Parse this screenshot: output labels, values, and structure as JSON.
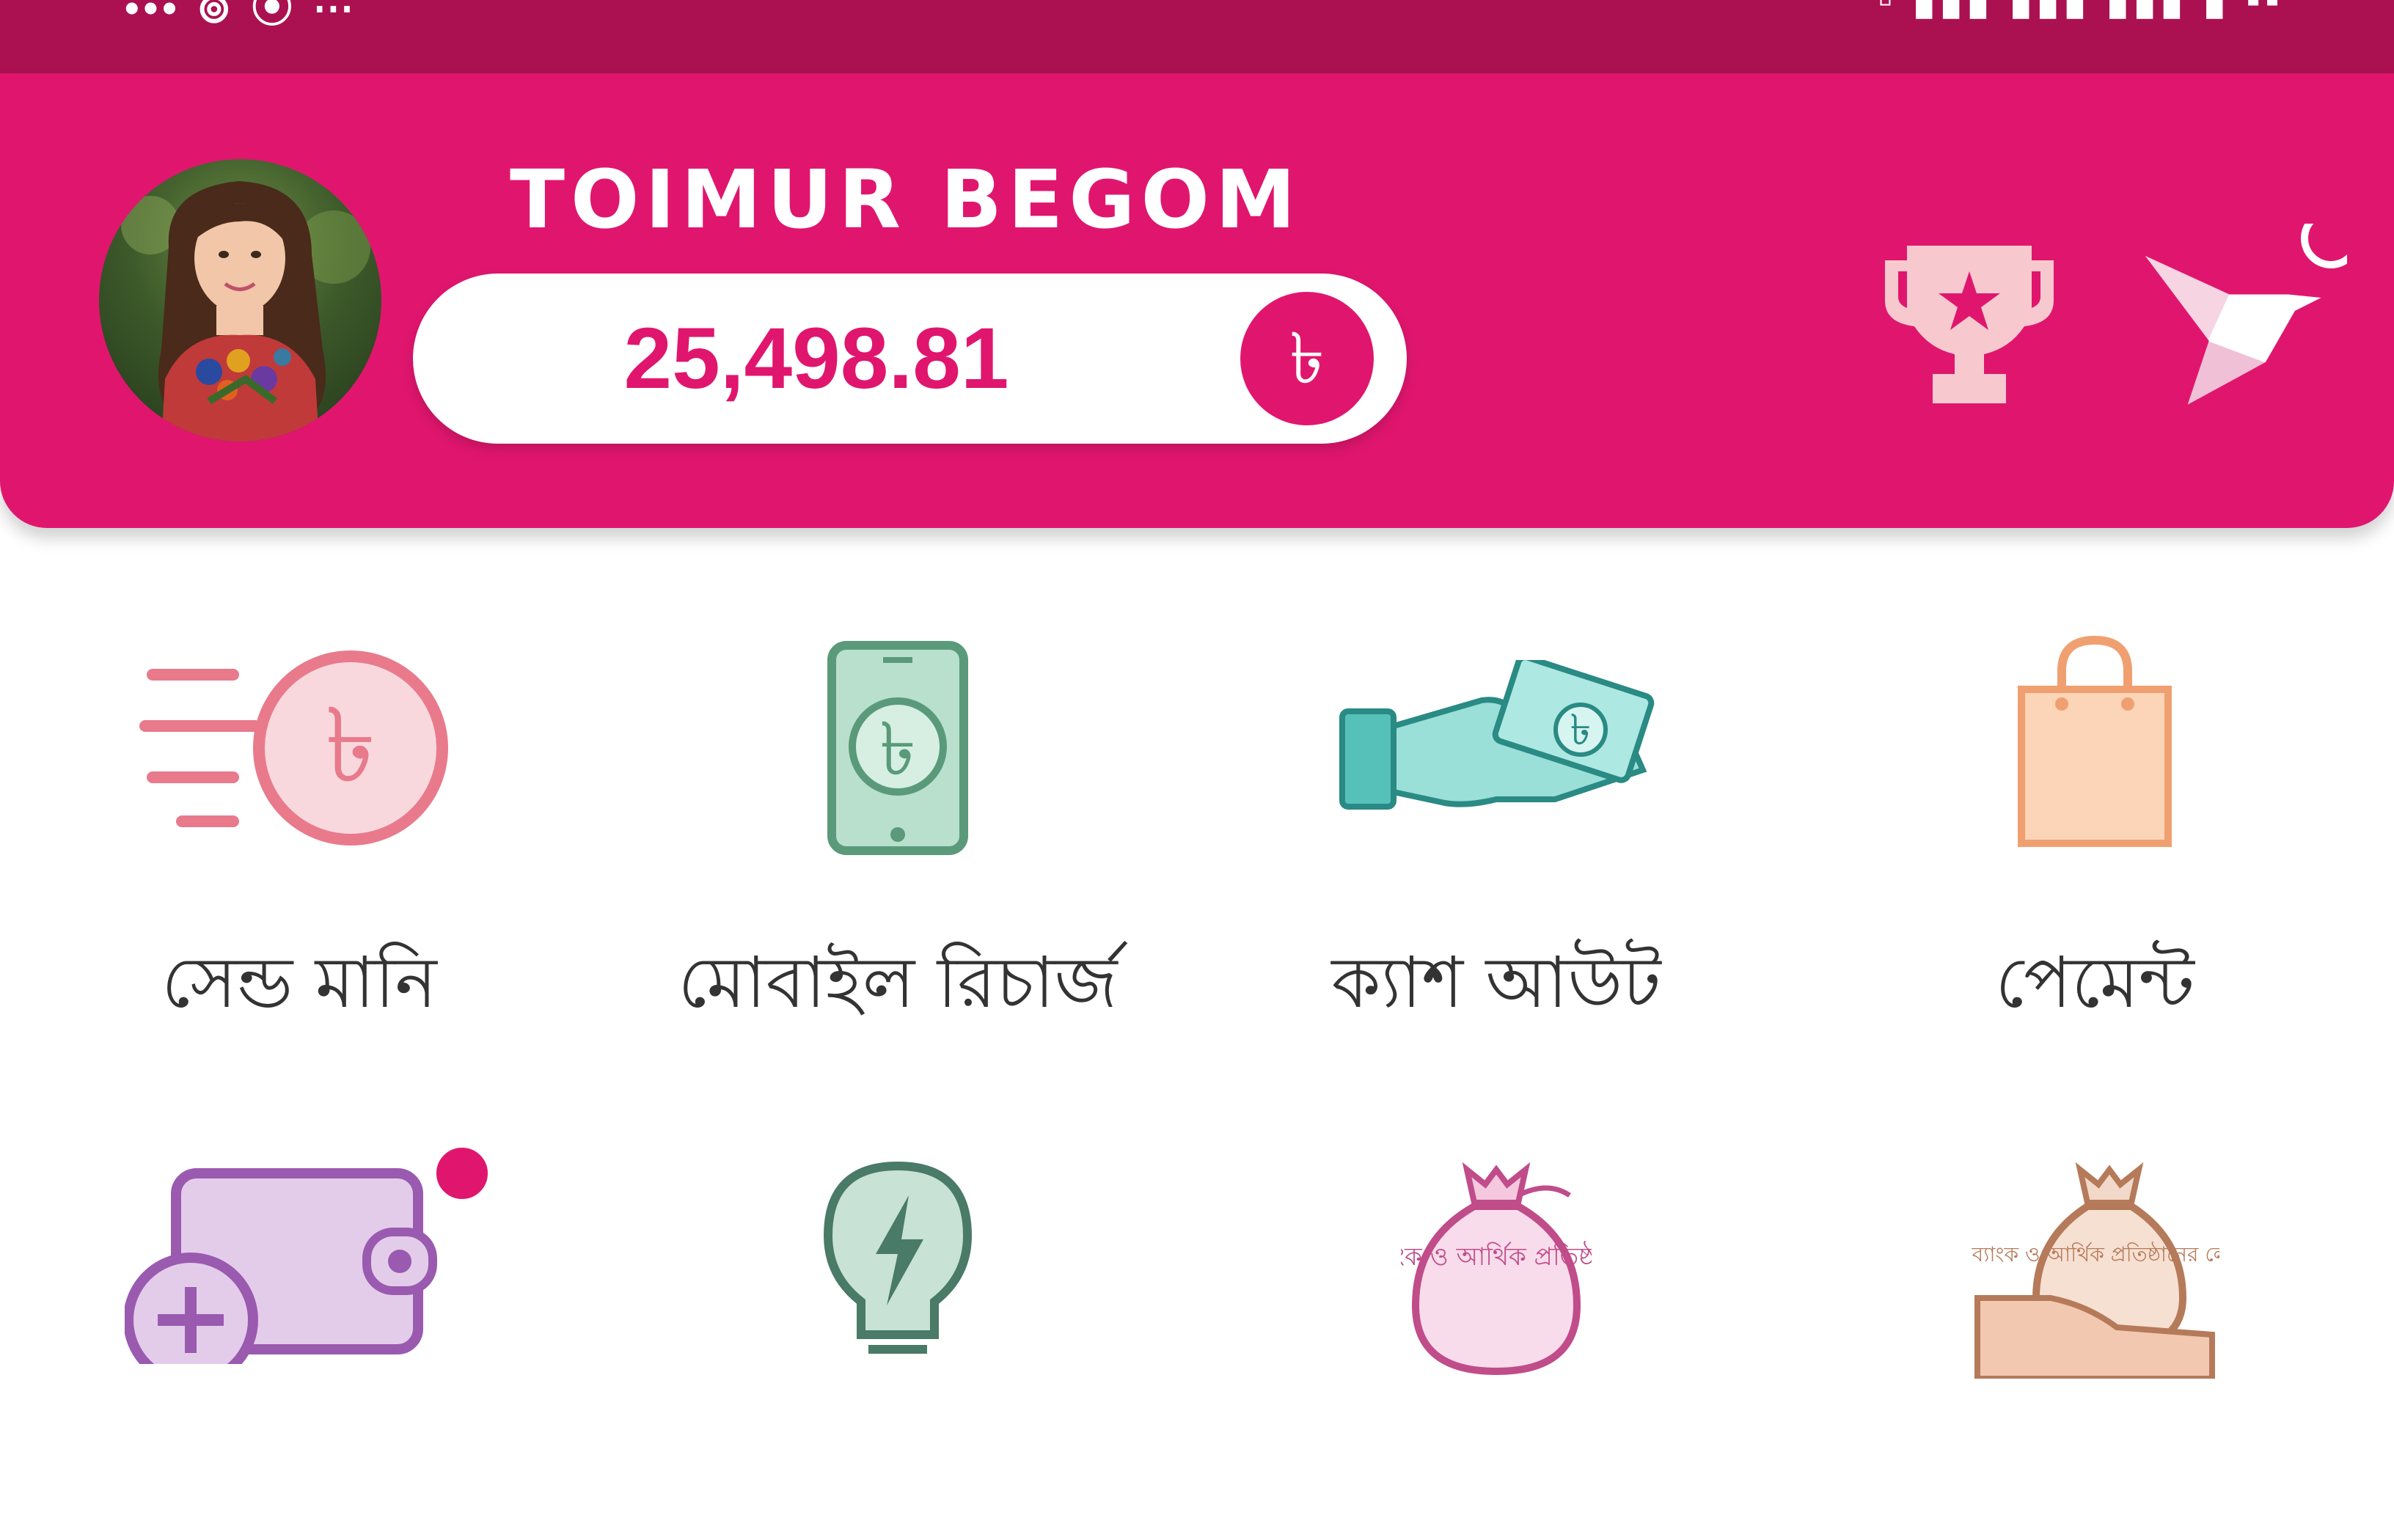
{
  "status_bar": {
    "left_text": "•••  ⊚  ⦿  ⋯",
    "right_text": "▫ ▮▮▮ ▮▮▮ ▮▮▮ ▮ ▪▪"
  },
  "header": {
    "user_name": "TOIMUR BEGOM",
    "balance": "25,498.81",
    "currency_symbol": "৳",
    "icons": [
      "avatar",
      "trophy-icon",
      "origami-bird-icon"
    ]
  },
  "services": [
    {
      "label": "সেন্ড মানি",
      "icon": "send-money-icon"
    },
    {
      "label": "মোবাইল রিচার্জ",
      "icon": "mobile-recharge-icon"
    },
    {
      "label": "ক্যাশ আউট",
      "icon": "cash-out-icon"
    },
    {
      "label": "পেমেন্ট",
      "icon": "payment-bag-icon"
    }
  ],
  "services_row2": [
    {
      "label": "",
      "icon": "add-money-wallet-icon"
    },
    {
      "label": "",
      "icon": "pay-bill-bulb-icon"
    },
    {
      "label": "ব্যাংক ও আর্থিক প্রতিষ্ঠানে",
      "icon": "bank-bag-icon"
    },
    {
      "label": "ব্যাংক ও আর্থিক প্রতিষ্ঠানের লোন",
      "icon": "loan-bag-icon"
    }
  ],
  "colors": {
    "status_bar": "#ab1151",
    "brand": "#e0166e",
    "send_money": "#e87a8c",
    "mobile": "#5a9a7a",
    "cash_out": "#3ab7ad",
    "payment": "#f0a070",
    "wallet": "#9a5ab0",
    "bulb": "#4a7a68",
    "bank_bag": "#c04c8a",
    "loan_bag": "#b57a5a"
  }
}
